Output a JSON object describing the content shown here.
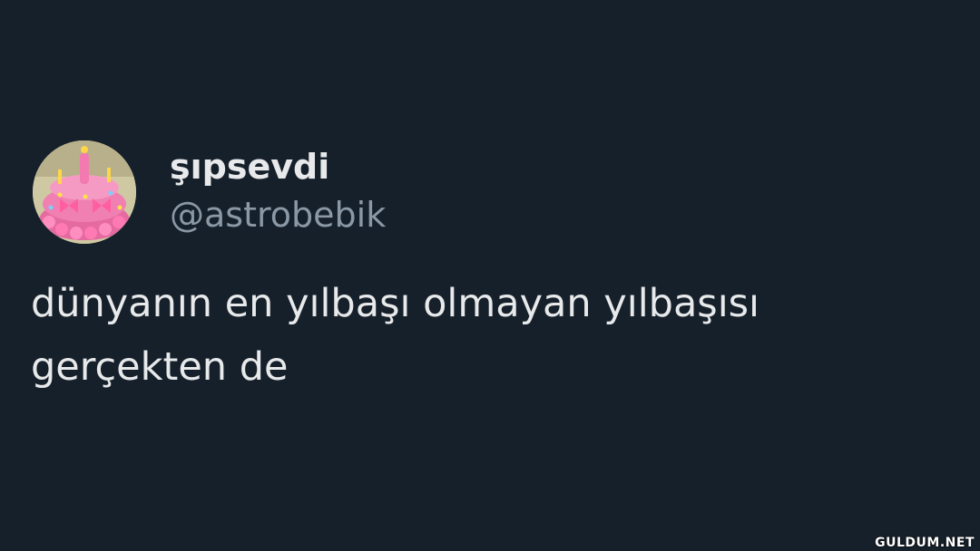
{
  "tweet": {
    "avatar_icon": "balloon-birthday-cake-avatar",
    "display_name": "şıpsevdi",
    "handle": "@astrobebik",
    "text_lines": [
      "dünyanın en yılbaşı olmayan yılbaşısı",
      "gerçekten de"
    ]
  },
  "watermark": "GULDUM.NET",
  "colors": {
    "background": "#16202b",
    "primary_text": "#e7e9ea",
    "secondary_text": "#8b98a5"
  }
}
